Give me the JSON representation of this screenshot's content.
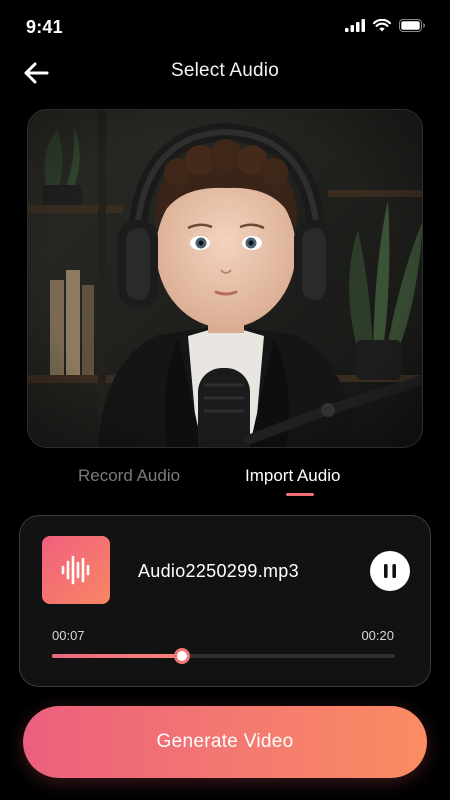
{
  "status_bar": {
    "time": "9:41",
    "icons": [
      "cellular-signal-icon",
      "wifi-icon",
      "battery-icon"
    ]
  },
  "header": {
    "title": "Select Audio",
    "back_icon": "arrow-left-icon"
  },
  "preview_image": {
    "subject": "toddler wearing headphones in front of a microphone"
  },
  "tabs": [
    {
      "label": "Record Audio",
      "active": false
    },
    {
      "label": "Import Audio",
      "active": true
    }
  ],
  "audio_item": {
    "file_name": "Audio2250299.mp3",
    "thumbnail_icon": "audio-waveform-icon",
    "control_icon": "pause-icon",
    "current_time": "00:07",
    "total_time": "00:20",
    "progress_percent": 38
  },
  "actions": {
    "generate_label": "Generate Video"
  },
  "colors": {
    "accent_start": "#ec5f7e",
    "accent_end": "#fb8c62",
    "tab_indicator": "#f2707a",
    "background": "#000000",
    "card_background": "#121212"
  }
}
